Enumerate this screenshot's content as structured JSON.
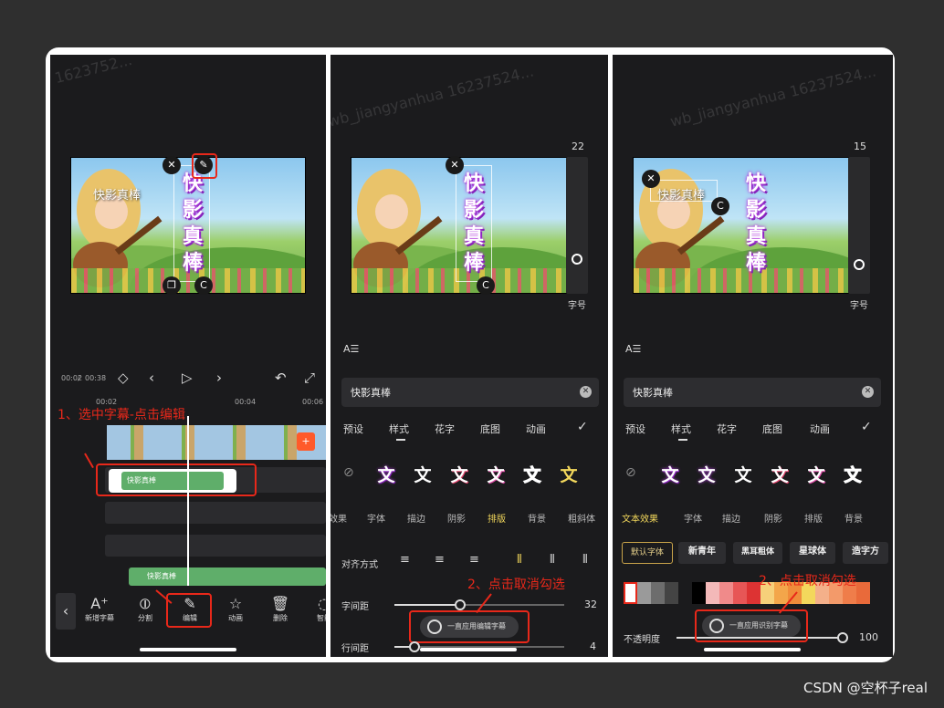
{
  "panel1": {
    "watermark": "1623752...",
    "caption_main": "快影真棒",
    "caption_vertical": [
      "快",
      "影",
      "真",
      "棒"
    ],
    "time_current": "00:02",
    "time_total": "00:38",
    "ruler_marks": [
      "00:02",
      "00:04",
      "00:06"
    ],
    "subtitle_clip_label": "快影真棒",
    "auto_sub_clip_label": "快影真棒",
    "annotation": "1、选中字幕-点击编辑",
    "tools": [
      {
        "icon": "A⁺",
        "label": "新增字幕"
      },
      {
        "icon": "⦶",
        "label": "分割"
      },
      {
        "icon": "✎",
        "label": "编辑"
      },
      {
        "icon": "☆",
        "label": "动画"
      },
      {
        "icon": "🗑",
        "label": "删除"
      },
      {
        "icon": "◌",
        "label": "智能"
      }
    ]
  },
  "panel2": {
    "watermark": "wb_jiangyanhua 16237524...",
    "caption_vertical": [
      "快",
      "影",
      "真",
      "棒"
    ],
    "size_value": "22",
    "size_label": "字号",
    "input_text": "快影真棒",
    "tabs": [
      "预设",
      "样式",
      "花字",
      "底图",
      "动画"
    ],
    "style_glyphs": [
      "文",
      "文",
      "文",
      "文",
      "文",
      "文"
    ],
    "subtabs": [
      "效果",
      "字体",
      "描边",
      "阴影",
      "排版",
      "背景",
      "粗斜体"
    ],
    "align_label": "对齐方式",
    "letter_spacing_label": "字间距",
    "letter_spacing_value": "32",
    "line_spacing_label": "行间距",
    "line_spacing_value": "4",
    "apply_all_label": "一直应用编辑字幕",
    "annotation": "2、点击取消勾选"
  },
  "panel3": {
    "watermark": "wb_jiangyanhua 16237524...",
    "caption_main": "快影真棒",
    "caption_vertical": [
      "快",
      "影",
      "真",
      "棒"
    ],
    "size_value": "15",
    "size_label": "字号",
    "input_text": "快影真棒",
    "tabs": [
      "预设",
      "样式",
      "花字",
      "底图",
      "动画"
    ],
    "style_glyphs": [
      "文",
      "文",
      "文",
      "文",
      "文",
      "文"
    ],
    "subtabs": [
      "文本效果",
      "字体",
      "描边",
      "阴影",
      "排版",
      "背景"
    ],
    "fonts": [
      "默认字体",
      "新青年",
      "黑耳粗体",
      "星球体",
      "造字方"
    ],
    "opacity_label": "不透明度",
    "opacity_value": "100",
    "apply_all_label": "一直应用识别字幕",
    "annotation": "2、点击取消勾选"
  },
  "footer": "CSDN @空杯子real",
  "colors": {
    "annotation_red": "#e8281a",
    "panel_bg": "#1b1b1d",
    "caption_glow": "#b53fe0",
    "clip_green": "#5fae6a"
  }
}
